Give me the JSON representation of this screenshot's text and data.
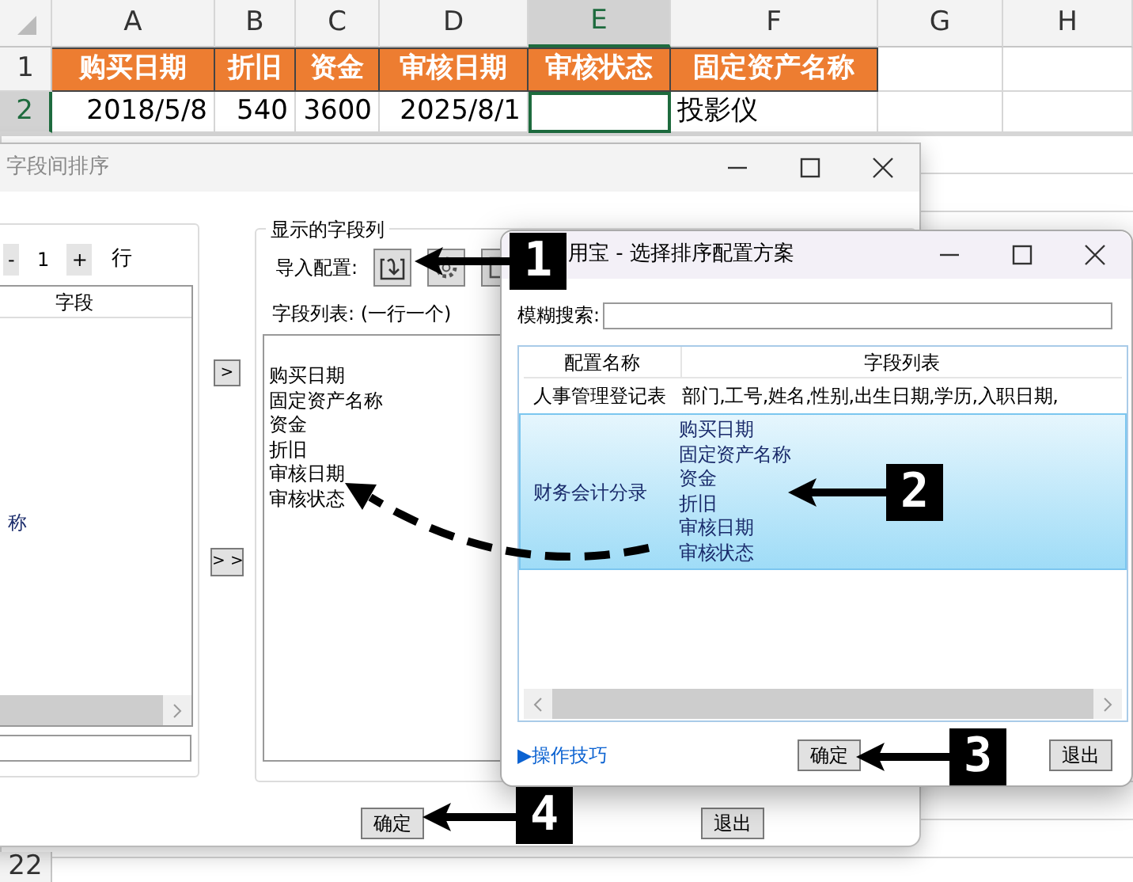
{
  "spreadsheet": {
    "columns": [
      {
        "label": "A",
        "selected": false
      },
      {
        "label": "B",
        "selected": false
      },
      {
        "label": "C",
        "selected": false
      },
      {
        "label": "D",
        "selected": false
      },
      {
        "label": "E",
        "selected": true
      },
      {
        "label": "F",
        "selected": false
      },
      {
        "label": "G",
        "selected": false
      },
      {
        "label": "H",
        "selected": false
      }
    ],
    "rows": [
      {
        "number": "1",
        "kind": "header",
        "selected": false,
        "cells": [
          {
            "text": "购买日期"
          },
          {
            "text": "折旧"
          },
          {
            "text": "资金"
          },
          {
            "text": "审核日期"
          },
          {
            "text": "审核状态"
          },
          {
            "text": "固定资产名称"
          }
        ]
      },
      {
        "number": "2",
        "kind": "data",
        "selected": true,
        "cells": [
          {
            "text": "2018/5/8",
            "kind": "number",
            "selected": false
          },
          {
            "text": "540",
            "kind": "number",
            "selected": false
          },
          {
            "text": "3600",
            "kind": "number",
            "selected": false
          },
          {
            "text": "2025/8/1",
            "kind": "number",
            "selected": false
          },
          {
            "kind": "text",
            "selected": true
          },
          {
            "text": "投影仪",
            "kind": "text",
            "selected": false
          }
        ]
      }
    ],
    "lower_row_number": "22"
  },
  "sort_dialog": {
    "title": "字段间排序",
    "spinner": {
      "minus": "-",
      "value": "1",
      "plus": "+"
    },
    "row_label": "行",
    "field_list": {
      "column": "字段",
      "items": [
        "称"
      ]
    },
    "add_button": ">",
    "add_all_button": "> >",
    "group_title": "显示的字段列",
    "import_label": "导入配置:",
    "list_label": "字段列表: (一行一个)",
    "fields": [
      "购买日期",
      "固定资产名称",
      "资金",
      "折旧",
      "审核日期",
      "审核状态"
    ],
    "ok_button": "确定",
    "cancel_button": "退出"
  },
  "config_dialog": {
    "title": "用宝 - 选择排序配置方案",
    "search_label": "模糊搜索:",
    "table": {
      "columns": [
        "配置名称",
        "字段列表"
      ],
      "rows": [
        {
          "name": "人事管理登记表",
          "fields": [
            "部门,工号,姓名,性别,出生日期,学历,入职日期,"
          ],
          "selected": false
        },
        {
          "name": "财务会计分录",
          "fields": [
            "购买日期",
            "固定资产名称",
            "资金",
            "折旧",
            "审核日期",
            "审核状态"
          ],
          "selected": true
        }
      ]
    },
    "tips_link": "▶操作技巧",
    "ok_button": "确定",
    "cancel_button": "退出"
  },
  "callouts": [
    {
      "label": "1"
    },
    {
      "label": "2"
    },
    {
      "label": "3"
    },
    {
      "label": "4"
    }
  ]
}
